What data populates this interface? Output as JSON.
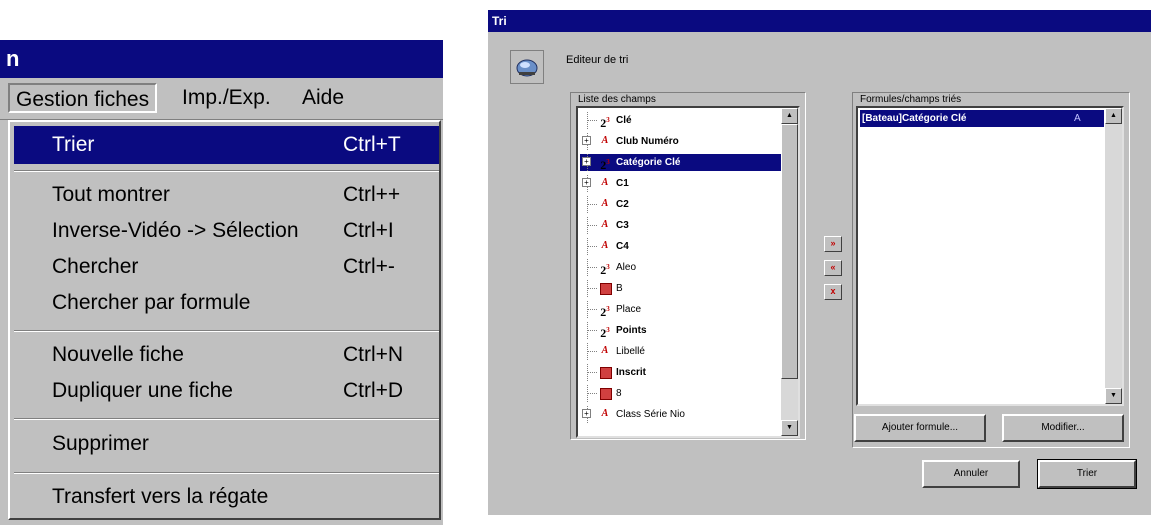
{
  "menu_window": {
    "title_fragment": "n",
    "menubar": [
      "Gestion fiches",
      "Imp./Exp.",
      "Aide"
    ],
    "items": [
      {
        "label": "Trier",
        "shortcut": "Ctrl+T",
        "selected": true
      },
      {
        "label": "Tout montrer",
        "shortcut": "Ctrl++"
      },
      {
        "label": "Inverse-Vidéo -> Sélection",
        "shortcut": "Ctrl+I"
      },
      {
        "label": "Chercher",
        "shortcut": "Ctrl+-"
      },
      {
        "label": "Chercher par formule",
        "shortcut": ""
      },
      {
        "label": "Nouvelle fiche",
        "shortcut": "Ctrl+N"
      },
      {
        "label": "Dupliquer une fiche",
        "shortcut": "Ctrl+D"
      },
      {
        "label": "Supprimer",
        "shortcut": ""
      },
      {
        "label": "Transfert vers la régate",
        "shortcut": ""
      }
    ]
  },
  "dialog": {
    "title": "Tri",
    "editor_label": "Editeur de tri",
    "fields_panel_title": "Liste des champs",
    "fields": [
      {
        "name": "Clé",
        "icon": "number-icon",
        "bold": true,
        "expandable": false
      },
      {
        "name": "Club Numéro",
        "icon": "text-icon",
        "bold": true,
        "expandable": true
      },
      {
        "name": "Catégorie Clé",
        "icon": "number-icon",
        "bold": true,
        "expandable": true,
        "selected": true
      },
      {
        "name": "C1",
        "icon": "text-icon",
        "bold": true,
        "expandable": true
      },
      {
        "name": "C2",
        "icon": "text-icon",
        "bold": true,
        "expandable": false
      },
      {
        "name": "C3",
        "icon": "text-icon",
        "bold": true,
        "expandable": false
      },
      {
        "name": "C4",
        "icon": "text-icon",
        "bold": true,
        "expandable": false
      },
      {
        "name": "Aleo",
        "icon": "number-icon",
        "bold": false,
        "expandable": false
      },
      {
        "name": "B",
        "icon": "picture-icon",
        "bold": false,
        "expandable": false
      },
      {
        "name": "Place",
        "icon": "number-icon",
        "bold": false,
        "expandable": false
      },
      {
        "name": "Points",
        "icon": "number-icon",
        "bold": true,
        "expandable": false
      },
      {
        "name": "Libellé",
        "icon": "text-icon",
        "bold": false,
        "expandable": false
      },
      {
        "name": "Inscrit",
        "icon": "picture-icon",
        "bold": true,
        "expandable": false
      },
      {
        "name": "8",
        "icon": "picture-icon",
        "bold": false,
        "expandable": false
      },
      {
        "name": "Class Série Nio",
        "icon": "text-icon",
        "bold": false,
        "expandable": true
      }
    ],
    "sorted_panel_title": "Formules/champs triés",
    "sorted_items": [
      {
        "text": "[Bateau]Catégorie Clé",
        "order": "A"
      }
    ],
    "mid_buttons": [
      "»",
      "«",
      "x"
    ],
    "add_formula_label": "Ajouter formule...",
    "modify_label": "Modifier...",
    "cancel_label": "Annuler",
    "sort_label": "Trier"
  }
}
